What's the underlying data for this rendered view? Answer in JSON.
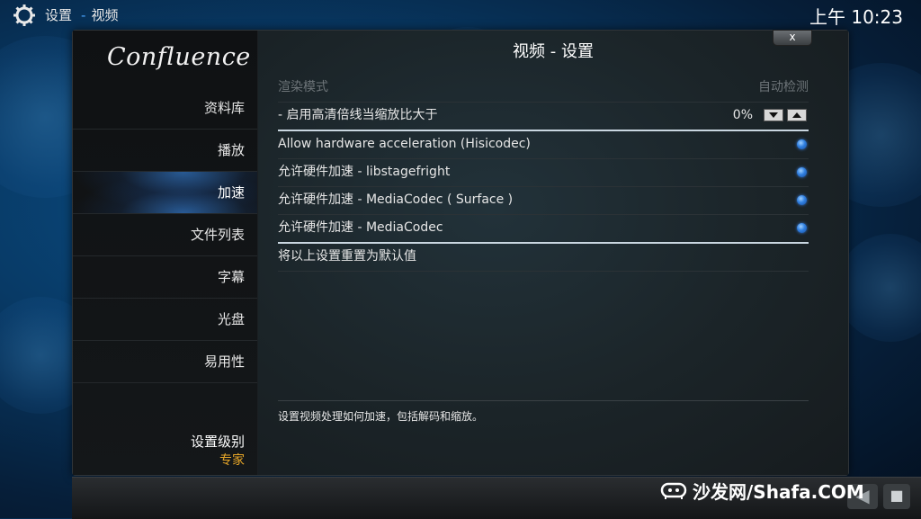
{
  "topbar": {
    "breadcrumb_root": "设置",
    "breadcrumb_page": "视频",
    "clock": "上午 10:23"
  },
  "sidebar": {
    "logo": "Confluence",
    "items": [
      {
        "label": "资料库"
      },
      {
        "label": "播放"
      },
      {
        "label": "加速",
        "active": true
      },
      {
        "label": "文件列表"
      },
      {
        "label": "字幕"
      },
      {
        "label": "光盘"
      },
      {
        "label": "易用性"
      }
    ],
    "level_label": "设置级别",
    "level_value": "专家"
  },
  "dialog": {
    "title": "视频 - 设置",
    "close_label": "x",
    "settings": [
      {
        "label": "渲染模式",
        "value": "自动检测",
        "disabled": true
      },
      {
        "label": "- 启用高清倍线当缩放比大于",
        "value": "0%",
        "type": "spinner"
      },
      {
        "label": "Allow hardware acceleration (Hisicodec)",
        "type": "radio",
        "checked": true
      },
      {
        "label": "允许硬件加速 - libstagefright",
        "type": "radio",
        "checked": true
      },
      {
        "label": "允许硬件加速 - MediaCodec ( Surface )",
        "type": "radio",
        "checked": true
      },
      {
        "label": "允许硬件加速 - MediaCodec",
        "type": "radio",
        "checked": true
      },
      {
        "label": "将以上设置重置为默认值"
      }
    ],
    "description": "设置视频处理如何加速，包括解码和缩放。"
  },
  "watermark": {
    "text": "沙发网/Shafa.COM"
  },
  "nav": {
    "back_icon": "back-arrow-icon",
    "home_icon": "home-icon"
  },
  "colors": {
    "accent": "#2f7fe0",
    "level_value": "#e7a628"
  }
}
